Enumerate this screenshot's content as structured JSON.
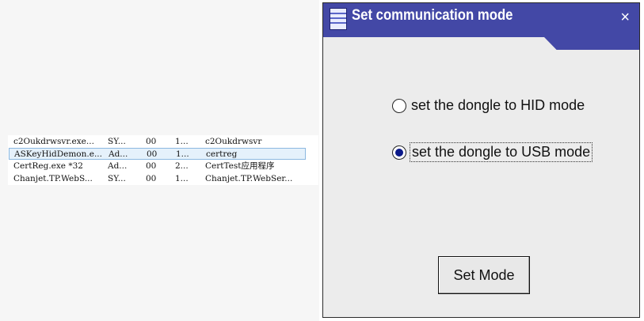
{
  "task_manager": {
    "rows": [
      {
        "name": "c2Oukdrwsvr.exe...",
        "user": "SY...",
        "cpu": "00",
        "mem": "1...",
        "desc": "c2Oukdrwsvr"
      },
      {
        "name": "ASKeyHidDemon.e...",
        "user": "Ad...",
        "cpu": "00",
        "mem": "1...",
        "desc": "certreg"
      },
      {
        "name": "CertReg.exe *32",
        "user": "Ad...",
        "cpu": "00",
        "mem": "2...",
        "desc": "CertTest应用程序"
      },
      {
        "name": "Chanjet.TP.WebS...",
        "user": "SY...",
        "cpu": "00",
        "mem": "1...",
        "desc": "Chanjet.TP.WebSer..."
      }
    ],
    "selected_index": 1
  },
  "dialog": {
    "title": "Set communication mode",
    "close_label": "×",
    "options": [
      {
        "label": "set the dongle to HID mode",
        "checked": false
      },
      {
        "label": "set the dongle to USB mode",
        "checked": true
      }
    ],
    "button_label": "Set Mode"
  }
}
